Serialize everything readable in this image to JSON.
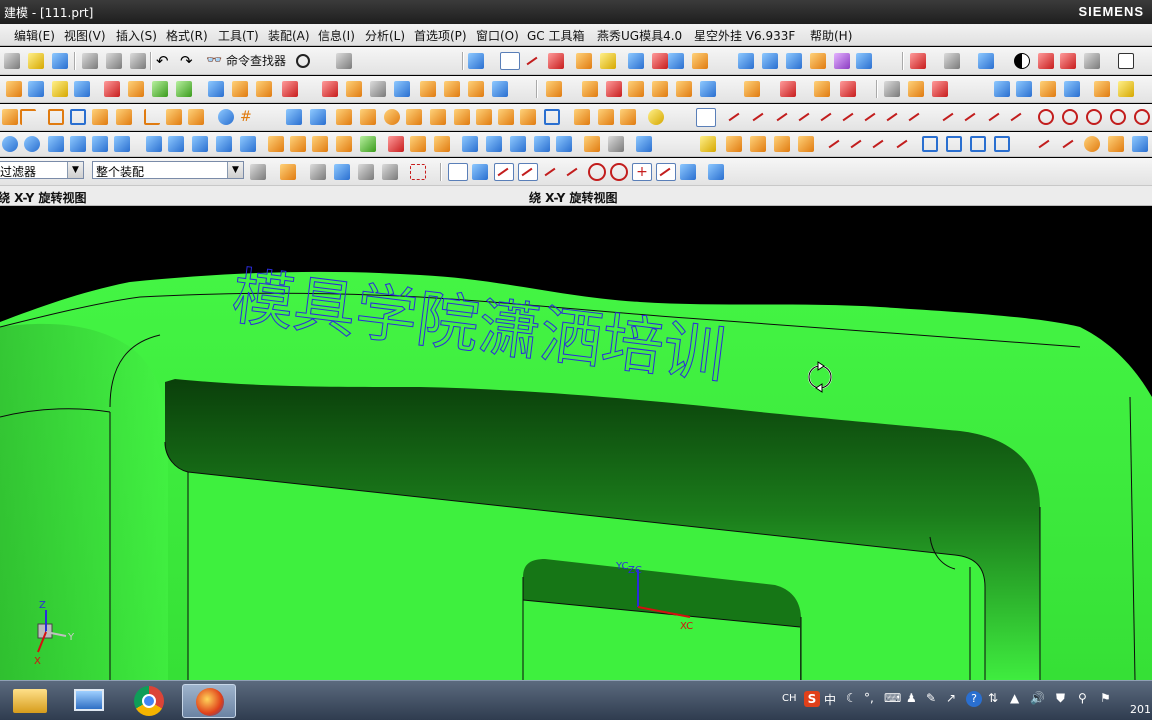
{
  "window": {
    "title": "建模 - [111.prt]",
    "brand": "SIEMENS"
  },
  "menu": [
    "编辑(E)",
    "视图(V)",
    "插入(S)",
    "格式(R)",
    "工具(T)",
    "装配(A)",
    "信息(I)",
    "分析(L)",
    "首选项(P)",
    "窗口(O)",
    "GC 工具箱",
    "燕秀UG模具4.0",
    "星空外挂 V6.933F",
    "帮助(H)"
  ],
  "toolbar": {
    "command_finder": "命令查找器"
  },
  "selection": {
    "filter_value": "过滤器",
    "scope_value": "整个装配"
  },
  "views": {
    "left_label": "绕 X-Y 旋转视图",
    "right_label": "绕 X-Y 旋转视图"
  },
  "viewport": {
    "watermark": "模具学院潇洒培训",
    "axis_labels": {
      "yc": "YC",
      "zc": "ZC",
      "xc": "XC"
    },
    "triad": {
      "z": "Z",
      "y": "Y",
      "x": "X"
    },
    "model_color": "#3ef03e",
    "watermark_color": "#2b2bdc"
  },
  "taskbar": {
    "lang": "CH",
    "ime": "中",
    "clock": "201"
  },
  "colors": {
    "menubar": "#e8e8e8",
    "titlebar": "#2a2a2a",
    "taskbar": "#3c4a5c"
  }
}
